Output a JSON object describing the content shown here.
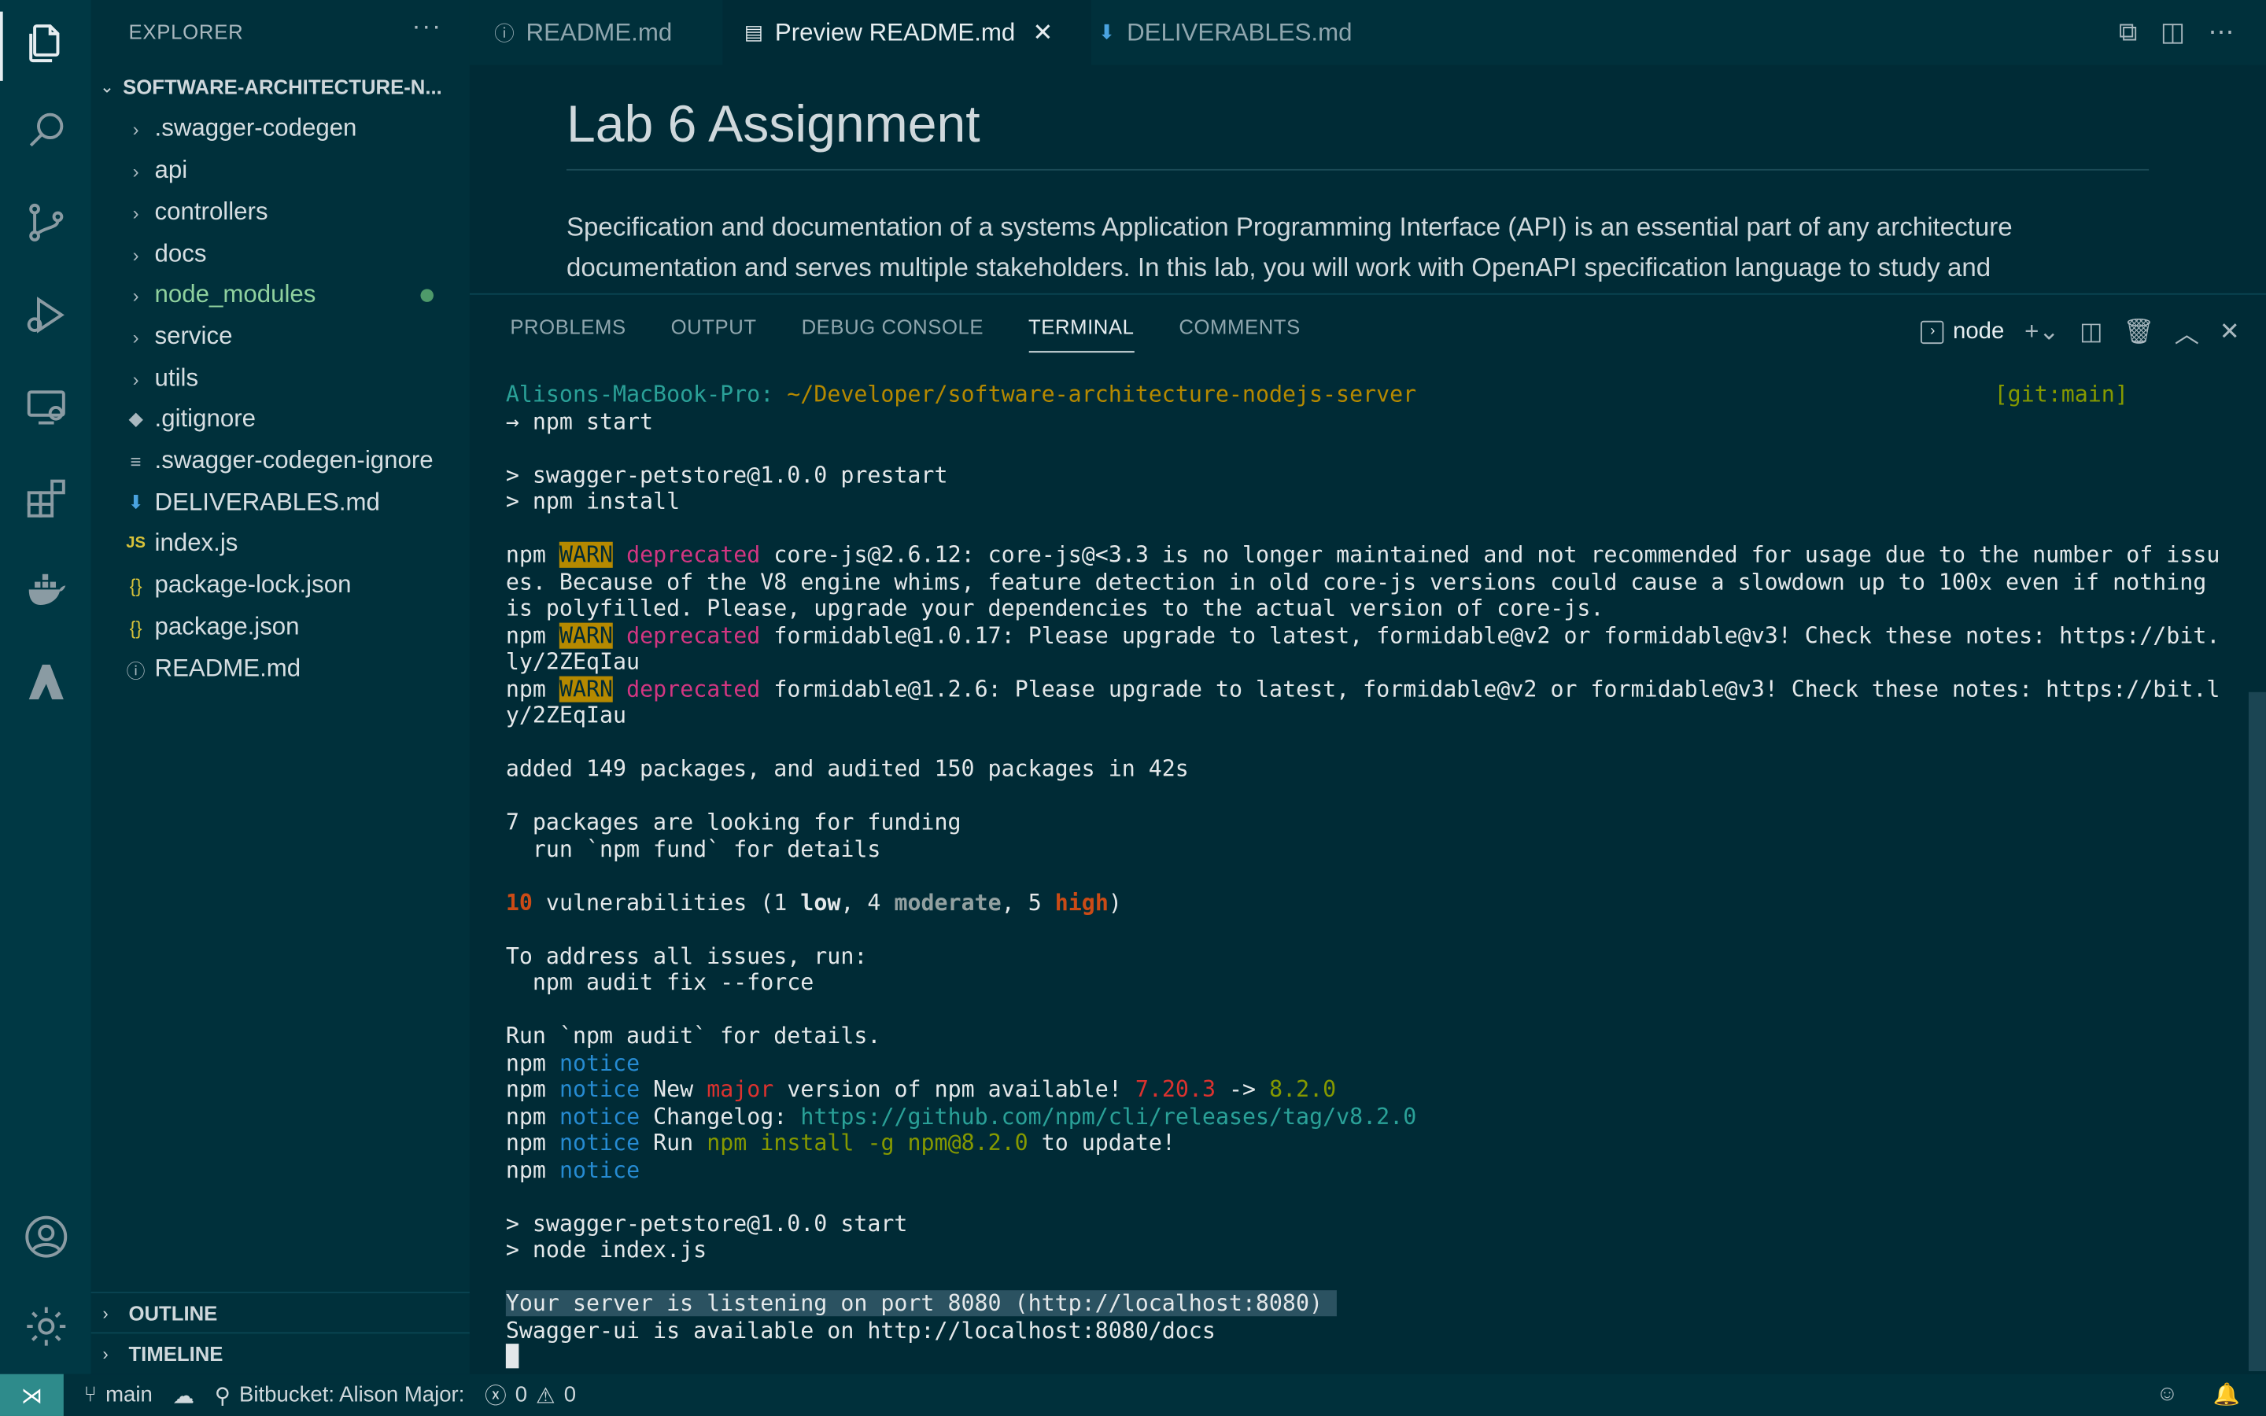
{
  "colors": {
    "background": "#002b36",
    "activity_bar": "#003844",
    "accent_remote": "#2e8b8b"
  },
  "activity_bar": {
    "icons": [
      "files-icon",
      "search-icon",
      "source-control-icon",
      "run-debug-icon",
      "remote-explorer-icon",
      "extensions-icon",
      "docker-icon",
      "azure-icon",
      "account-icon",
      "settings-gear-icon"
    ]
  },
  "sidebar": {
    "title": "EXPLORER",
    "more": "···",
    "root_folder": "SOFTWARE-ARCHITECTURE-N...",
    "items": [
      {
        "name": ".swagger-codegen",
        "icon": "chevron-right"
      },
      {
        "name": "api",
        "icon": "chevron-right"
      },
      {
        "name": "controllers",
        "icon": "chevron-right"
      },
      {
        "name": "docs",
        "icon": "chevron-right"
      },
      {
        "name": "node_modules",
        "icon": "chevron-right",
        "modified": true
      },
      {
        "name": "service",
        "icon": "chevron-right"
      },
      {
        "name": "utils",
        "icon": "chevron-right"
      },
      {
        "name": ".gitignore",
        "icon": "git-diamond"
      },
      {
        "name": ".swagger-codegen-ignore",
        "icon": "lines"
      },
      {
        "name": "DELIVERABLES.md",
        "icon": "markdown-down-arrow"
      },
      {
        "name": "index.js",
        "icon": "JS"
      },
      {
        "name": "package-lock.json",
        "icon": "braces"
      },
      {
        "name": "package.json",
        "icon": "braces"
      },
      {
        "name": "README.md",
        "icon": "info"
      }
    ],
    "sections": [
      "OUTLINE",
      "TIMELINE"
    ]
  },
  "tabs": [
    {
      "label": "README.md",
      "icon": "info"
    },
    {
      "label": "Preview README.md",
      "icon": "preview",
      "active": true,
      "close": "✕"
    },
    {
      "label": "DELIVERABLES.md",
      "icon": "markdown-down-arrow"
    }
  ],
  "preview": {
    "heading": "Lab 6 Assignment",
    "paragraph": "Specification and documentation of a systems Application Programming Interface (API) is an essential part of any architecture documentation and serves multiple stakeholders. In this lab, you will work with OpenAPI specification language to study and"
  },
  "panel": {
    "tabs": [
      "PROBLEMS",
      "OUTPUT",
      "DEBUG CONSOLE",
      "TERMINAL",
      "COMMENTS"
    ],
    "active_tab": "TERMINAL",
    "terminal_name": "node"
  },
  "terminal": {
    "host": "Alisons-MacBook-Pro:",
    "path": "~/Developer/software-architecture-nodejs-server",
    "git": "[git:main]",
    "cmd": "→ npm start",
    "l_prestart": "> swagger-petstore@1.0.0 prestart",
    "l_npminstall": "> npm install",
    "npm": "npm",
    "warn": "WARN",
    "deprecated": "deprecated",
    "w1a": " core-js@2.6.12: core-js@<3.3 is no longer maintained and not recommended for usage due to the number of issu",
    "w1b": "es. Because of the V8 engine whims, feature detection in old core-js versions could cause a slowdown up to 100x even if nothing",
    "w1c": "is polyfilled. Please, upgrade your dependencies to the actual version of core-js.",
    "w2a": " formidable@1.0.17: Please upgrade to latest, formidable@v2 or formidable@v3! Check these notes: https://bit.",
    "w2b": "ly/2ZEqIau",
    "w3a": " formidable@1.2.6: Please upgrade to latest, formidable@v2 or formidable@v3! Check these notes: https://bit.l",
    "w3b": "y/2ZEqIau",
    "added": "added 149 packages, and audited 150 packages in 42s",
    "funding1": "7 packages are looking for funding",
    "funding2": "  run `npm fund` for details",
    "vuln_count": "10",
    "vuln_text1": " vulnerabilities (1 ",
    "low": "low",
    "vuln_text2": ", 4 ",
    "moderate": "moderate",
    "vuln_text3": ", 5 ",
    "high": "high",
    "vuln_text4": ")",
    "address1": "To address all issues, run:",
    "address2": "  npm audit fix --force",
    "audit": "Run `npm audit` for details.",
    "notice": "notice",
    "n_new": " New ",
    "major": "major",
    "n_ver": " version of npm available! ",
    "v_old": "7.20.3",
    "arrow": " -> ",
    "v_new": "8.2.0",
    "n_changelog": " Changelog: ",
    "changelog_url": "https://github.com/npm/cli/releases/tag/v8.2.0",
    "n_run": " Run ",
    "install_cmd": "npm install -g npm@8.2.0",
    "to_update": " to update!",
    "l_start": "> swagger-petstore@1.0.0 start",
    "l_node": "> node index.js",
    "listening": "Your server is listening on port 8080 (http://localhost:8080) ",
    "swagger": "Swagger-ui is available on http://localhost:8080/docs"
  },
  "statusbar": {
    "branch": "main",
    "bitbucket": "Bitbucket: Alison Major:",
    "errors": "0",
    "warnings": "0"
  }
}
